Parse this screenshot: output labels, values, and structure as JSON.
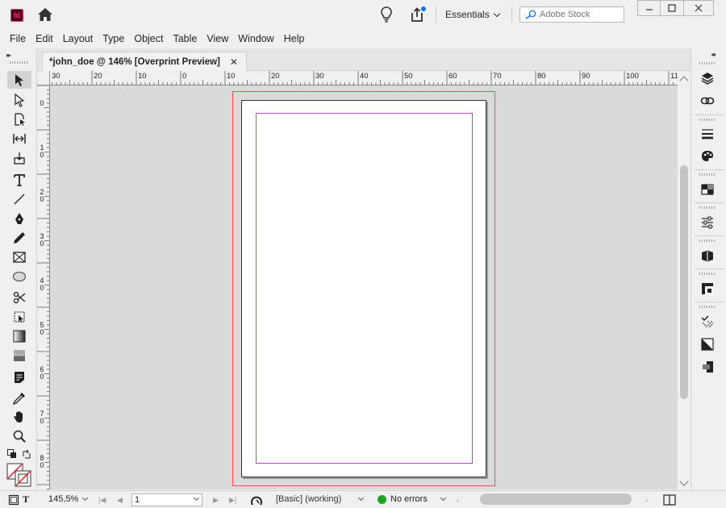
{
  "app": {
    "logo_text": "Id"
  },
  "workspace": {
    "label": "Essentials"
  },
  "stock_search": {
    "placeholder": "Adobe Stock"
  },
  "menu": [
    "File",
    "Edit",
    "Layout",
    "Type",
    "Object",
    "Table",
    "View",
    "Window",
    "Help"
  ],
  "document_tab": {
    "title": "*john_doe @ 146% [Overprint Preview]",
    "close": "✕"
  },
  "ruler_h_labels": [
    "30",
    "20",
    "10",
    "0",
    "10",
    "20",
    "30",
    "40",
    "50",
    "60",
    "70",
    "80",
    "90",
    "100",
    "11"
  ],
  "ruler_v_labels": [
    "0",
    "1 0",
    "2 0",
    "3 0",
    "4 0",
    "5 0",
    "6 0",
    "7 0",
    "8 0"
  ],
  "status": {
    "zoom": "145,5%",
    "page": "1",
    "preflight_profile": "[Basic] (working)",
    "errors": "No errors",
    "error_status_color": "#22a022"
  },
  "colors": {
    "bleed_guide": "#ff4d4d",
    "margin_guide": "#c040e0"
  },
  "tools": [
    "selection-tool",
    "direct-selection-tool",
    "page-tool",
    "gap-tool",
    "content-collector-tool",
    "type-tool",
    "line-tool",
    "pen-tool",
    "pencil-tool",
    "rectangle-frame-tool",
    "ellipse-tool",
    "scissors-tool",
    "free-transform-tool",
    "gradient-swatch-tool",
    "gradient-feather-tool",
    "note-tool",
    "eyedropper-tool",
    "hand-tool",
    "zoom-tool"
  ],
  "panels": [
    "pages-panel",
    "links-panel",
    "stroke-panel",
    "color-panel",
    "swatches-panel",
    "properties-panel",
    "cc-libraries-panel",
    "text-wrap-panel",
    "effects-panel",
    "gradient-panel",
    "layers-align-panel"
  ]
}
